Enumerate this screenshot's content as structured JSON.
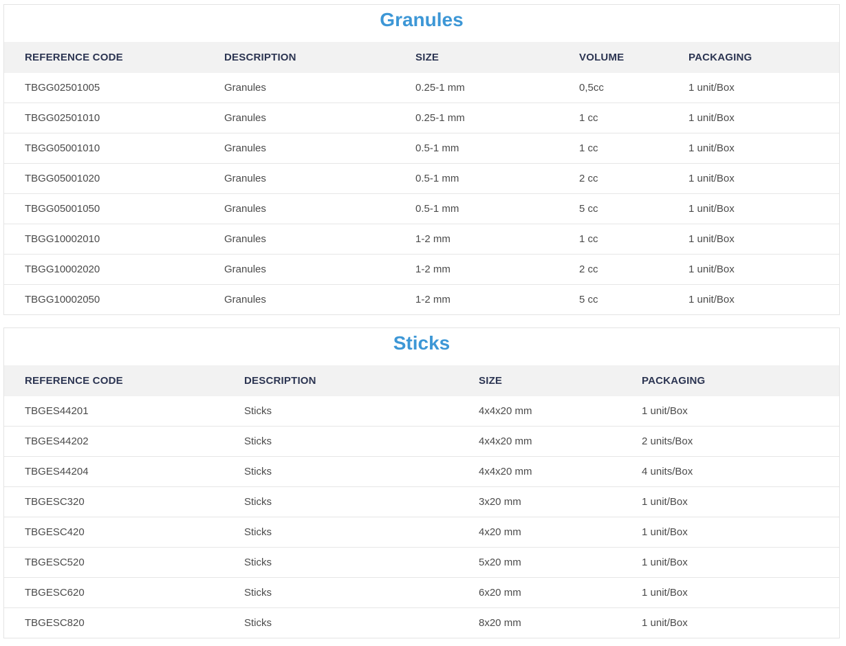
{
  "granules": {
    "title": "Granules",
    "headers": [
      "REFERENCE CODE",
      "DESCRIPTION",
      "SIZE",
      "VOLUME",
      "PACKAGING"
    ],
    "rows": [
      [
        "TBGG02501005",
        "Granules",
        "0.25-1 mm",
        "0,5cc",
        "1 unit/Box"
      ],
      [
        "TBGG02501010",
        "Granules",
        "0.25-1 mm",
        "1 cc",
        "1 unit/Box"
      ],
      [
        "TBGG05001010",
        "Granules",
        "0.5-1 mm",
        "1 cc",
        "1 unit/Box"
      ],
      [
        "TBGG05001020",
        "Granules",
        "0.5-1 mm",
        "2 cc",
        "1 unit/Box"
      ],
      [
        "TBGG05001050",
        "Granules",
        "0.5-1 mm",
        "5 cc",
        "1 unit/Box"
      ],
      [
        "TBGG10002010",
        "Granules",
        "1-2 mm",
        "1 cc",
        "1 unit/Box"
      ],
      [
        "TBGG10002020",
        "Granules",
        "1-2 mm",
        "2 cc",
        "1 unit/Box"
      ],
      [
        "TBGG10002050",
        "Granules",
        "1-2 mm",
        "5 cc",
        "1 unit/Box"
      ]
    ]
  },
  "sticks": {
    "title": "Sticks",
    "headers": [
      "REFERENCE CODE",
      "DESCRIPTION",
      "SIZE",
      "PACKAGING"
    ],
    "rows": [
      [
        "TBGES44201",
        "Sticks",
        "4x4x20 mm",
        "1 unit/Box"
      ],
      [
        "TBGES44202",
        "Sticks",
        "4x4x20 mm",
        "2 units/Box"
      ],
      [
        "TBGES44204",
        "Sticks",
        "4x4x20 mm",
        "4 units/Box"
      ],
      [
        "TBGESC320",
        "Sticks",
        "3x20 mm",
        "1 unit/Box"
      ],
      [
        "TBGESC420",
        "Sticks",
        "4x20 mm",
        "1 unit/Box"
      ],
      [
        "TBGESC520",
        "Sticks",
        "5x20 mm",
        "1 unit/Box"
      ],
      [
        "TBGESC620",
        "Sticks",
        "6x20 mm",
        "1 unit/Box"
      ],
      [
        "TBGESC820",
        "Sticks",
        "8x20 mm",
        "1 unit/Box"
      ]
    ]
  },
  "colors": {
    "title": "#3d97d6",
    "header_text": "#2c3552",
    "header_bg": "#f2f2f2",
    "cell_text": "#4a4a4a"
  }
}
